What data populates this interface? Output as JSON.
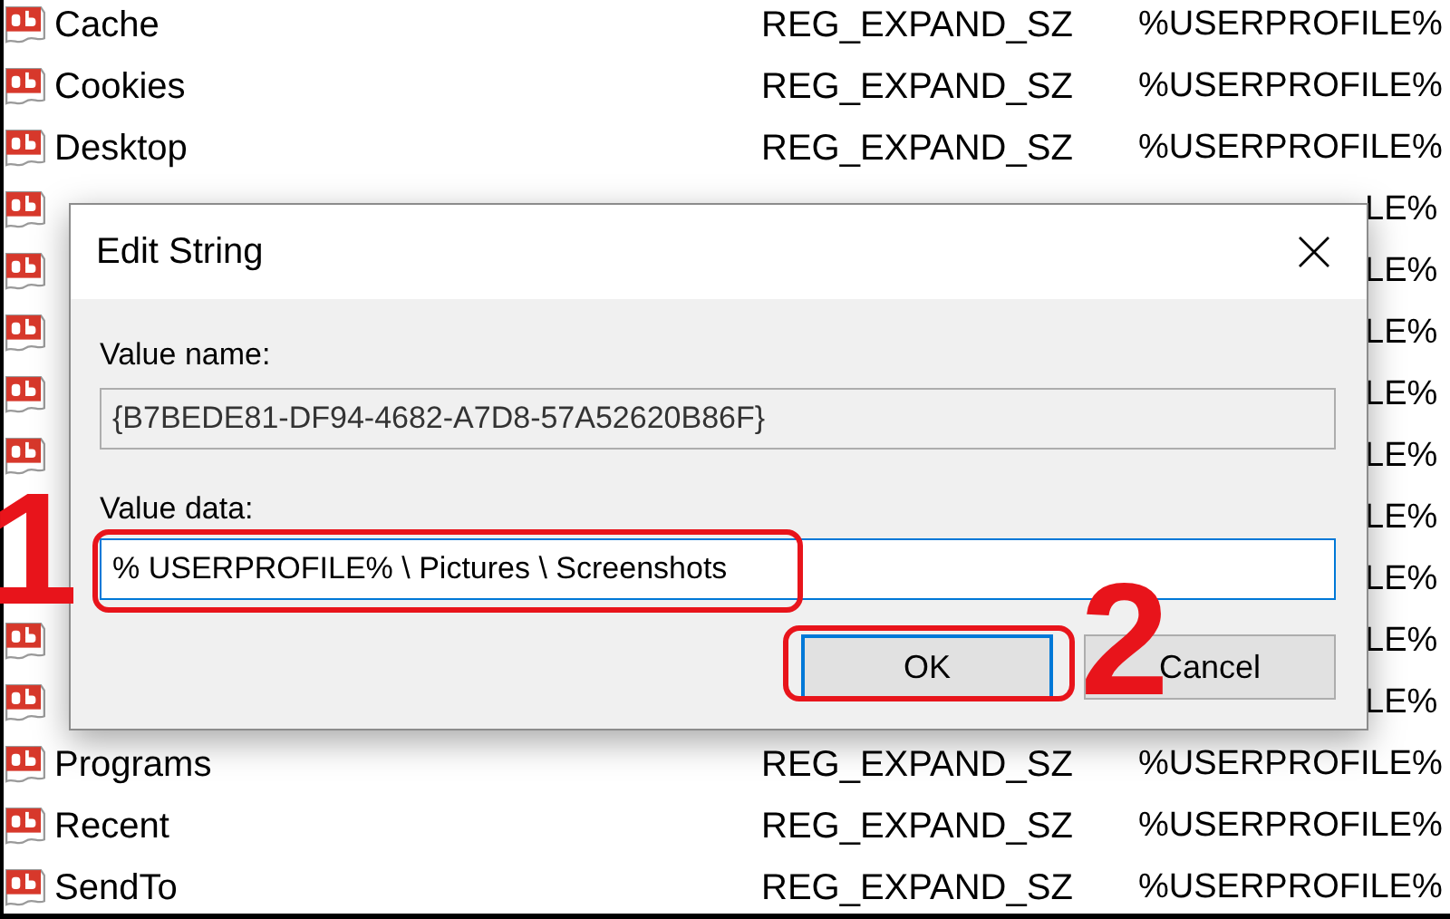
{
  "registry_values": [
    {
      "kind": "full",
      "name": "Cache",
      "type": "REG_EXPAND_SZ",
      "data": "%USERPROFILE%"
    },
    {
      "kind": "full",
      "name": "Cookies",
      "type": "REG_EXPAND_SZ",
      "data": "%USERPROFILE%"
    },
    {
      "kind": "full",
      "name": "Desktop",
      "type": "REG_EXPAND_SZ",
      "data": "%USERPROFILE%"
    },
    {
      "kind": "covered",
      "data": "LE%"
    },
    {
      "kind": "covered",
      "data": "LE%"
    },
    {
      "kind": "covered",
      "data": "LE%"
    },
    {
      "kind": "covered",
      "data": "LE%"
    },
    {
      "kind": "covered",
      "data": "LE%"
    },
    {
      "kind": "marked",
      "data": "LE%"
    },
    {
      "kind": "marked",
      "data": "LE%"
    },
    {
      "kind": "covered",
      "data": "LE%"
    },
    {
      "kind": "covered",
      "data": "LE%"
    },
    {
      "kind": "full",
      "name": "Programs",
      "type": "REG_EXPAND_SZ",
      "data": "%USERPROFILE%"
    },
    {
      "kind": "full",
      "name": "Recent",
      "type": "REG_EXPAND_SZ",
      "data": "%USERPROFILE%"
    },
    {
      "kind": "full",
      "name": "SendTo",
      "type": "REG_EXPAND_SZ",
      "data": "%USERPROFILE%"
    }
  ],
  "dialog": {
    "title": "Edit String",
    "value_name_label": "Value name:",
    "value_name": "{B7BEDE81-DF94-4682-A7D8-57A52620B86F}",
    "value_data_label": "Value data:",
    "value_data": "% USERPROFILE% \\ Pictures \\ Screenshots",
    "buttons": [
      {
        "label": "OK",
        "default": true
      },
      {
        "label": "Cancel",
        "default": false
      }
    ]
  },
  "annotations": [
    {
      "label": "1"
    },
    {
      "label": "2"
    }
  ]
}
